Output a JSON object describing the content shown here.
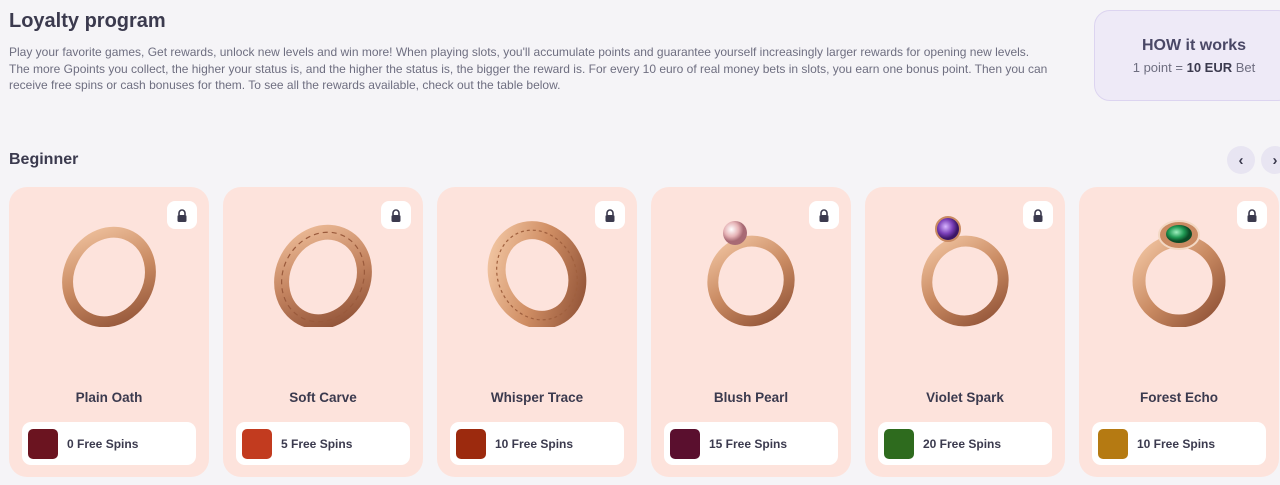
{
  "header": {
    "title": "Loyalty program",
    "intro": "Play your favorite games, Get rewards, unlock new levels and win more! When playing slots, you'll accumulate points and guarantee yourself increasingly larger rewards for opening new levels. The more Gpoints you collect, the higher your status is, and the higher the status is, the bigger the reward is. For every 10 euro of real money bets in slots, you earn one bonus point. Then you can receive free spins or cash bonuses for them. To see all the rewards available, check out the table below."
  },
  "how_it_works": {
    "title": "HOW it works",
    "rate_prefix": "1 point = ",
    "rate_value": "10 EUR",
    "rate_suffix": " Bet"
  },
  "section": {
    "title": "Beginner",
    "prev_icon": "chevron-left-icon",
    "next_icon": "chevron-right-icon",
    "prev_glyph": "‹",
    "next_glyph": "›"
  },
  "colors": {
    "card_bg": "#fde3dc",
    "ring_gold": "#c98a62",
    "accent_purple": "#eeeaf7"
  },
  "cards": [
    {
      "name": "Plain Oath",
      "reward": "0 Free Spins",
      "gem": "none",
      "thumb_color": "#6b1420"
    },
    {
      "name": "Soft Carve",
      "reward": "5 Free Spins",
      "gem": "none",
      "thumb_color": "#c23b1f"
    },
    {
      "name": "Whisper Trace",
      "reward": "10 Free Spins",
      "gem": "none",
      "thumb_color": "#9c2a0e"
    },
    {
      "name": "Blush Pearl",
      "reward": "15 Free Spins",
      "gem": "pearl",
      "thumb_color": "#5a0f2e"
    },
    {
      "name": "Violet Spark",
      "reward": "20 Free Spins",
      "gem": "amethyst",
      "thumb_color": "#2e6b1e"
    },
    {
      "name": "Forest Echo",
      "reward": "10 Free Spins",
      "gem": "emerald",
      "thumb_color": "#b57a12"
    }
  ]
}
